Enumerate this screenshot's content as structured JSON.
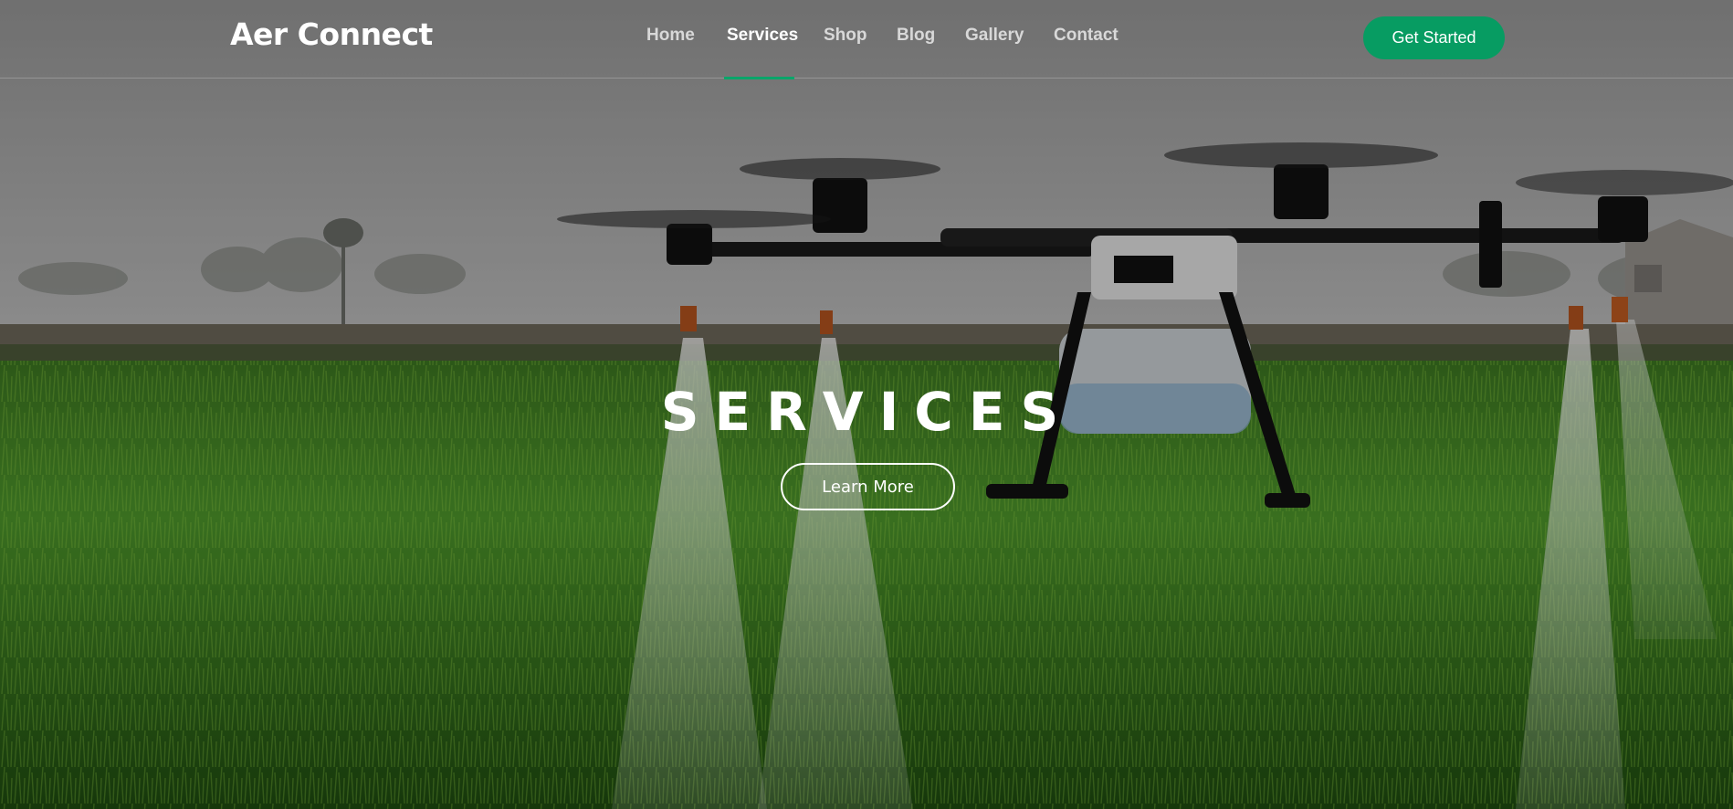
{
  "header": {
    "logo": "Aer Connect",
    "nav": [
      {
        "label": "Home",
        "active": false
      },
      {
        "label": "Services",
        "active": true
      },
      {
        "label": "Shop",
        "active": false
      },
      {
        "label": "Blog",
        "active": false
      },
      {
        "label": "Gallery",
        "active": false
      },
      {
        "label": "Contact",
        "active": false
      }
    ],
    "cta_label": "Get Started"
  },
  "hero": {
    "title": "SERVICES",
    "button_label": "Learn More",
    "image": "agricultural-drone-spraying-rice-field"
  },
  "colors": {
    "accent": "#079c62",
    "text": "#ffffff",
    "overlay": "rgba(0,0,0,0.35)"
  }
}
